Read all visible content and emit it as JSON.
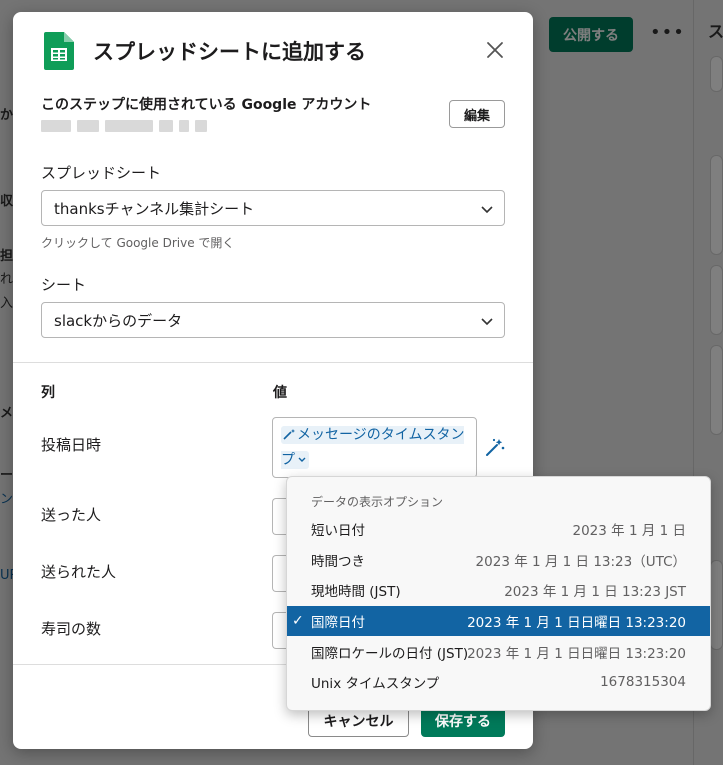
{
  "background": {
    "publish_label": "公開する",
    "more_label": "•••",
    "left_snippets": [
      "か",
      "収",
      "担",
      "れ",
      "入",
      "メ",
      "ー",
      "ン",
      "UR"
    ],
    "right_snippet": "ス"
  },
  "modal": {
    "title": "スプレッドシートに追加する",
    "icon": "google-sheets-icon",
    "close_icon": "close-icon",
    "account": {
      "label": "このステップに使用されている Google アカウント",
      "edit_label": "編集"
    },
    "spreadsheet": {
      "label": "スプレッドシート",
      "value": "thanksチャンネル集計シート",
      "help": "クリックして Google Drive で開く"
    },
    "sheet": {
      "label": "シート",
      "value": "slackからのデータ"
    },
    "columns": {
      "col_header": "列",
      "val_header": "値",
      "rows": [
        {
          "label": "投稿日時",
          "value_chip": "メッセージのタイムスタンプ"
        },
        {
          "label": "送った人"
        },
        {
          "label": "送られた人"
        },
        {
          "label": "寿司の数"
        }
      ]
    },
    "footer": {
      "cancel_label": "キャンセル",
      "save_label": "保存する"
    }
  },
  "dropdown": {
    "header": "データの表示オプション",
    "items": [
      {
        "label": "短い日付",
        "value": "2023 年 1 月 1 日",
        "selected": false
      },
      {
        "label": "時間つき",
        "value": "2023 年 1 月 1 日 13:23（UTC）",
        "selected": false
      },
      {
        "label": "現地時間 (JST)",
        "value": "2023 年 1 月 1 日 13:23 JST",
        "selected": false
      },
      {
        "label": "国際日付",
        "value": "2023 年 1 月 1 日日曜日 13:23:20",
        "selected": true
      },
      {
        "label": "国際ロケールの日付 (JST)",
        "value": "2023 年 1 月 1 日日曜日 13:23:20",
        "selected": false
      },
      {
        "label": "Unix タイムスタンプ",
        "value": "1678315304",
        "selected": false
      }
    ],
    "check_mark": "✓"
  },
  "colors": {
    "accent": "#1264a3",
    "brand_green": "#007a5a",
    "sheets_green": "#0f9d58"
  }
}
